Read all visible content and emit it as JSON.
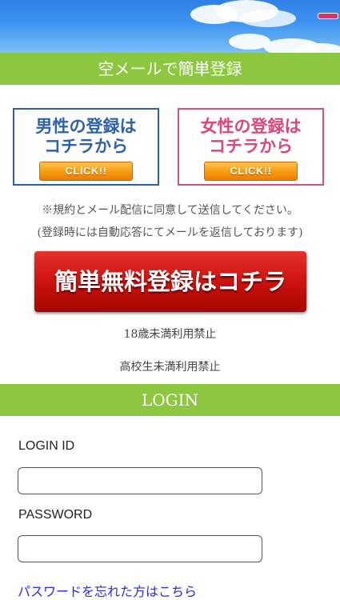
{
  "header": {
    "menu_icon": "menu-icon",
    "sky_colors": [
      "#2f7fe6",
      "#7cc0f7"
    ]
  },
  "register_section": {
    "title": "空メールで簡単登録",
    "male": {
      "line1": "男性の登録は",
      "line2": "コチラから",
      "button": "CLICK!!",
      "color": "#2d62a8"
    },
    "female": {
      "line1": "女性の登録は",
      "line2": "コチラから",
      "button": "CLICK!!",
      "color": "#d9487d"
    },
    "notice1": "※規約とメール配信に同意して送信してください。",
    "notice2": "(登録時には自動応答にてメールを返信しております)",
    "big_button": "簡単無料登録はコチラ",
    "age_note1": "18歳未満利用禁止",
    "age_note2": "高校生未満利用禁止"
  },
  "login_section": {
    "title": "LOGIN",
    "id_label": "LOGIN ID",
    "id_value": "",
    "password_label": "PASSWORD",
    "password_value": "",
    "forgot_link": "パスワードを忘れた方はこちら"
  },
  "colors": {
    "green_bar": "#8dc63f",
    "big_button": "#c8100c",
    "click_button": "#f79a12"
  }
}
